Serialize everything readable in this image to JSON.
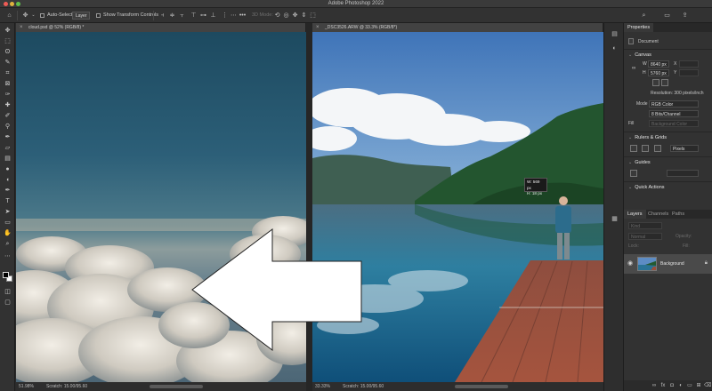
{
  "window": {
    "title": "Adobe Photoshop 2022"
  },
  "options_bar": {
    "auto_select_label": "Auto-Select:",
    "auto_select_value": "Layer",
    "transform_controls_label": "Show Transform Controls",
    "mode_3d_label": "3D Mode:"
  },
  "documents": [
    {
      "tab_label": "cloud.psd @ 52% (RGB/8) *",
      "zoom": "51.98%",
      "scratch": "Scratch: 15.00/95.60"
    },
    {
      "tab_label": "_DSC3526.ARW @ 33.3% (RGB/8*)",
      "zoom": "33.33%",
      "scratch": "Scratch: 15.00/95.60"
    }
  ],
  "readout": {
    "w": "W: 569 px",
    "h": "H: 18 px"
  },
  "properties": {
    "tab": "Properties",
    "document_label": "Document",
    "canvas_heading": "Canvas",
    "w_label": "W",
    "w_value": "8640 px",
    "h_label": "H",
    "h_value": "5760 px",
    "x_label": "X",
    "y_label": "Y",
    "resolution": "Resolution: 300 pixels/inch",
    "mode_label": "Mode",
    "mode_value": "RGB Color",
    "depth_value": "8 Bits/Channel",
    "fill_label": "Fill",
    "fill_value": "Background Color",
    "rulers_heading": "Rulers & Grids",
    "units_value": "Pixels",
    "guides_heading": "Guides",
    "quick_actions_heading": "Quick Actions"
  },
  "layers_panel": {
    "tabs": [
      "Layers",
      "Channels",
      "Paths"
    ],
    "kind_value": "Kind",
    "blend_value": "Normal",
    "opacity_label": "Opacity:",
    "lock_label": "Lock:",
    "fill_label": "Fill:",
    "layer_name": "Background"
  },
  "icons": {
    "home": "home-icon",
    "move": "move-icon",
    "eye": "eye-icon",
    "lock": "lock-icon"
  },
  "colors": {
    "ui_dark": "#323232",
    "panel_header": "#282828",
    "accent_selected": "#4a4a4a"
  }
}
